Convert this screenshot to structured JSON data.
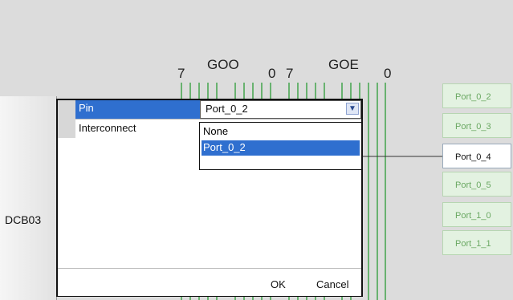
{
  "schematic": {
    "bus_labels": [
      "7",
      "GOO",
      "0",
      "7",
      "GOE",
      "0"
    ],
    "block_label": "DCB03",
    "ports": [
      "Port_0_2",
      "Port_0_3",
      "Port_0_4",
      "Port_0_5",
      "Port_1_0",
      "Port_1_1"
    ],
    "active_port": "Port_0_4",
    "colors": {
      "background": "#dcdcdc",
      "bus_lines": "#38a041",
      "port_fill": "#e3f2e1",
      "port_text": "#6aa862",
      "red_wire": "#e03a3a",
      "purple_wire": "#7a3fa7"
    }
  },
  "dialog": {
    "rows": [
      {
        "label": "Pin",
        "value": "Port_0_2"
      },
      {
        "label": "Interconnect",
        "value": ""
      }
    ],
    "dropdown_options": [
      "None",
      "Port_0_2"
    ],
    "selected_option": "Port_0_2",
    "ok_label": "OK",
    "cancel_label": "Cancel",
    "colors": {
      "selection": "#2f6fcf"
    }
  }
}
